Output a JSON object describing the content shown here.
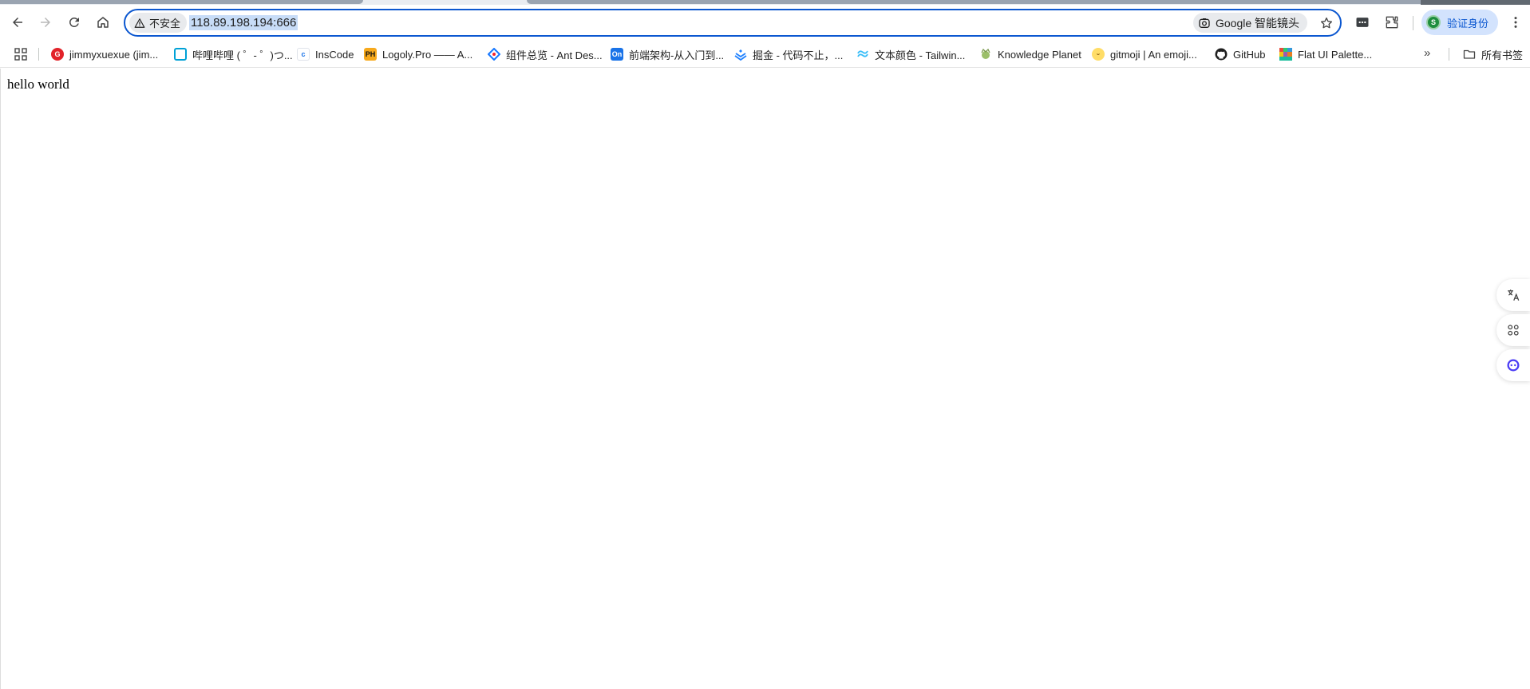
{
  "window": {
    "tab_accent": "#9aa4b1"
  },
  "toolbar": {
    "back_icon": "arrow-left-icon",
    "forward_icon": "arrow-right-icon",
    "reload_icon": "reload-icon",
    "home_icon": "home-icon",
    "security_label": "不安全",
    "url": "118.89.198.194:666",
    "lens_label": "Google 智能镜头",
    "profile_initial": "S",
    "profile_label": "验证身份",
    "accent": "#0b57d0"
  },
  "bookmarks": {
    "items": [
      {
        "label": "jimmyxuexue (jim...",
        "icon_color": "#e2232a",
        "icon_text": "G"
      },
      {
        "label": "哔哩哔哩 ( ゜- ゜)つ...",
        "icon_color": "#00a1d6",
        "icon_text": ""
      },
      {
        "label": "InsCode",
        "icon_color": "#ffffff",
        "icon_text": ""
      },
      {
        "label": "Logoly.Pro —— A...",
        "icon_color": "#f7a91c",
        "icon_text": "PH"
      },
      {
        "label": "组件总览 - Ant Des...",
        "icon_color": "#ffffff",
        "icon_text": ""
      },
      {
        "label": "前端架构-从入门到...",
        "icon_color": "#1a73e8",
        "icon_text": "On"
      },
      {
        "label": "掘金 - 代码不止，...",
        "icon_color": "#ffffff",
        "icon_text": ""
      },
      {
        "label": "文本颜色 - Tailwin...",
        "icon_color": "#ffffff",
        "icon_text": ""
      },
      {
        "label": "Knowledge Planet",
        "icon_color": "#ffffff",
        "icon_text": ""
      },
      {
        "label": "gitmoji | An emoji...",
        "icon_color": "#ffdd67",
        "icon_text": ""
      },
      {
        "label": "GitHub",
        "icon_color": "#ffffff",
        "icon_text": ""
      },
      {
        "label": "Flat UI Palette...",
        "icon_color": "#ffffff",
        "icon_text": ""
      }
    ],
    "more_label": "»",
    "all_bookmarks_label": "所有书签"
  },
  "page": {
    "body_text": "hello world"
  },
  "side_tools": {
    "items": [
      "translate-icon",
      "apps-grid-icon",
      "assistant-icon"
    ]
  }
}
